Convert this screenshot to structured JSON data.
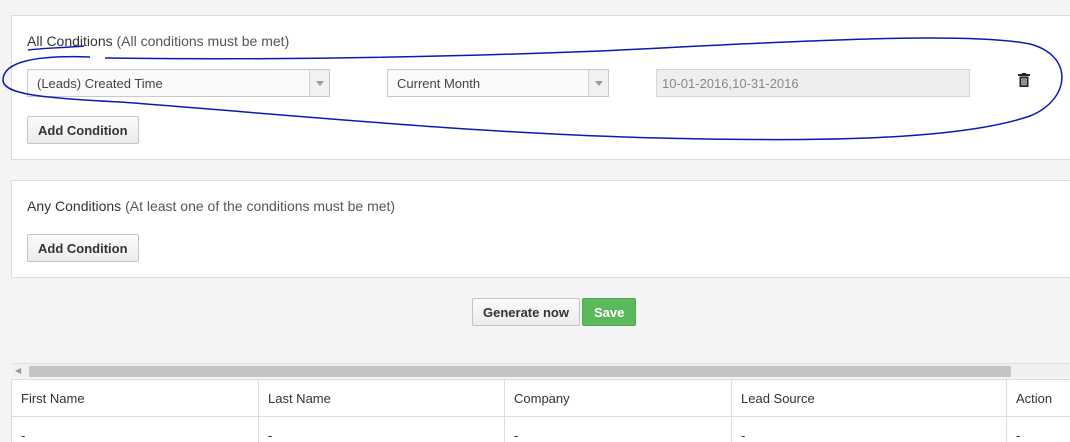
{
  "all_conditions": {
    "title": "All Conditions",
    "hint": "(All conditions must be met)",
    "condition": {
      "field": "(Leads) Created Time",
      "period": "Current Month",
      "date_range": "10-01-2016,10-31-2016"
    },
    "add_label": "Add Condition"
  },
  "any_conditions": {
    "title": "Any Conditions",
    "hint": "(At least one of the conditions must be met)",
    "add_label": "Add Condition"
  },
  "actions": {
    "generate_label": "Generate now",
    "save_label": "Save",
    "save_color": "#5cb85c"
  },
  "table": {
    "headers": [
      "First Name",
      "Last Name",
      "Company",
      "Lead Source",
      "Action"
    ],
    "rows": [
      [
        "-",
        "-",
        "-",
        "-",
        "-"
      ]
    ]
  },
  "annotation_color": "#0b1bb0",
  "icons": {
    "delete": "trash-icon",
    "dropdown": "caret-down-icon",
    "scroll_left": "arrow-left-icon"
  }
}
